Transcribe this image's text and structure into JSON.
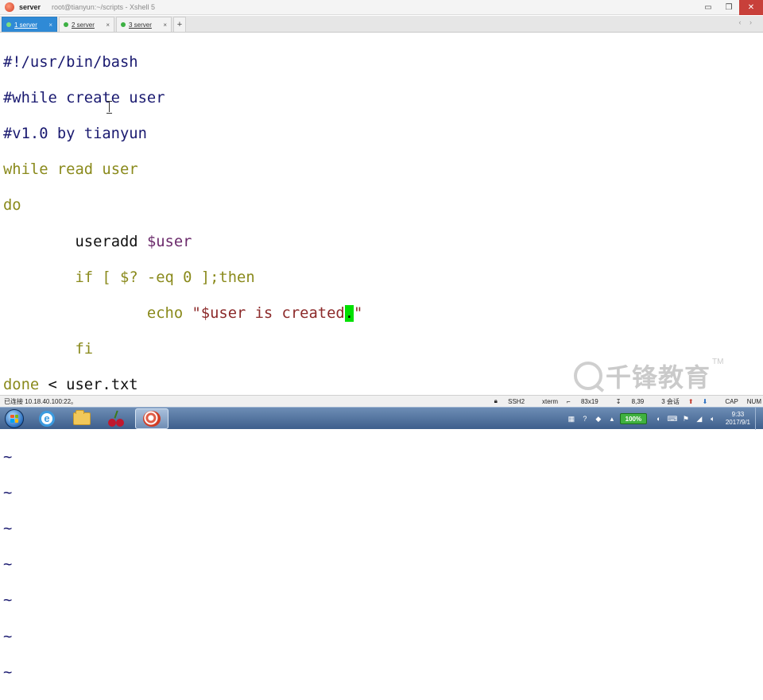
{
  "window": {
    "app_name": "server",
    "title": "root@tianyun:~/scripts - Xshell 5",
    "controls": {
      "minimize": "▭",
      "restore": "❐",
      "close": "✕"
    }
  },
  "tabs": [
    {
      "label": "1 server",
      "active": true,
      "close": "×"
    },
    {
      "label": "2 server",
      "active": false,
      "close": "×"
    },
    {
      "label": "3 server",
      "active": false,
      "close": "×"
    }
  ],
  "tab_add": "+",
  "tab_nav": "‹ ›",
  "terminal": {
    "lines": {
      "shebang": "#!/usr/bin/bash",
      "comment1": "#while create user",
      "comment2": "#v1.0 by tianyun",
      "while": "while",
      "read": "read",
      "user_word": "user",
      "do": "do",
      "indent1": "        ",
      "indent2": "                ",
      "useradd": "useradd",
      "var_user": "$user",
      "if_kw": "if",
      "if_test": " [ $? -eq 0 ];",
      "then_kw": "then",
      "echo": "echo",
      "str_open": " \"$user is created",
      "cursor_char": ".",
      "str_close": "\"",
      "fi": "fi",
      "done": "done",
      "redirect": " < user.txt",
      "tilde": "~"
    }
  },
  "watermark": {
    "text": "千锋教育",
    "tm": "TM"
  },
  "status": {
    "connection": "已连接 10.18.40.100:22。",
    "protocol": "SSH2",
    "term": "xterm",
    "size": "83x19",
    "cursor_pos": "8,39",
    "sessions": "3 会话",
    "caps": "CAP",
    "num": "NUM"
  },
  "taskbar": {
    "battery": "100%",
    "time": "9:33",
    "date": "2017/9/1"
  },
  "colors": {
    "tab_active": "#2f8ad6",
    "cursor": "#00e000",
    "keyword": "#8a8a1c",
    "comment": "#1a1a70"
  }
}
